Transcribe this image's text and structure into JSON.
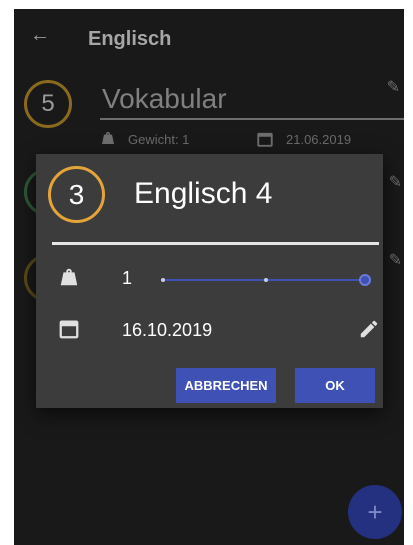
{
  "app_bar": {
    "back_icon": "arrow-left-icon",
    "title": "Englisch"
  },
  "list": {
    "items": [
      {
        "level": "5",
        "title": "Vokabular",
        "weight_text": "Gewicht: 1",
        "date": "21.06.2019"
      }
    ]
  },
  "dialog": {
    "level": "3",
    "title": "Englisch 4",
    "weight": {
      "icon": "weight-icon",
      "value": "1",
      "slider_steps": 3,
      "slider_position": 1.0
    },
    "date": {
      "icon": "calendar-icon",
      "value": "16.10.2019",
      "edit_icon": "pencil-icon"
    },
    "cancel_label": "ABBRECHEN",
    "ok_label": "OK"
  },
  "fab": {
    "label": "+"
  },
  "colors": {
    "accent": "#3f51b5",
    "level_ring_dialog": "#e3a53a",
    "level_ring_list": "#8a6a1c",
    "dialog_bg": "#3c3c3c",
    "app_bg": "#191919"
  }
}
